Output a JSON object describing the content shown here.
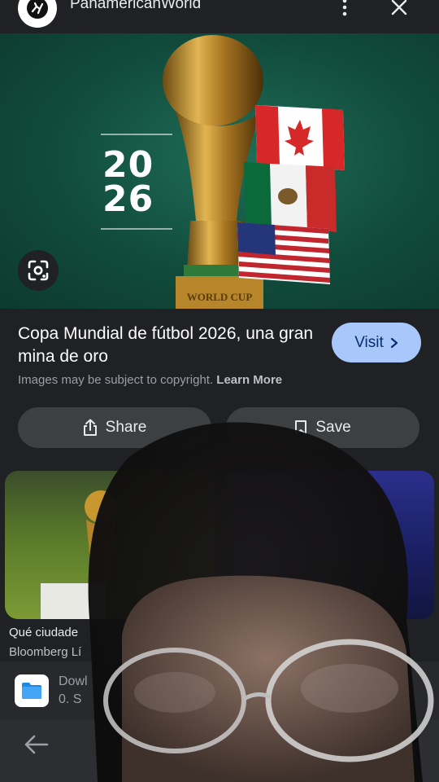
{
  "header": {
    "site_name": "PanamericanWorld",
    "logo_icon": "running-figure-logo-icon",
    "more_icon": "more-vert-icon",
    "close_icon": "close-icon"
  },
  "hero": {
    "year_top": "20",
    "year_bottom": "26",
    "trophy_base_text": "WORLD CUP",
    "lens_icon": "google-lens-icon"
  },
  "result": {
    "title": "Copa Mundial de fútbol 2026, una gran mina de oro",
    "visit_label": "Visit",
    "copyright_text": "Images may be subject to copyright.",
    "learn_more_label": "Learn More",
    "share_label": "Share",
    "save_label": "Save"
  },
  "related": [
    {
      "caption": "Qué ciudade",
      "source": "Bloomberg Lí"
    },
    {
      "caption": "",
      "source": ""
    }
  ],
  "download": {
    "title": "Dowl",
    "subtitle": "0. S"
  },
  "nav": {
    "back_icon": "arrow-back-icon"
  },
  "colors": {
    "background": "#202124",
    "visit_button": "#a8c7fa",
    "action_button": "#3c4043",
    "hero_green": "#114b3b"
  }
}
